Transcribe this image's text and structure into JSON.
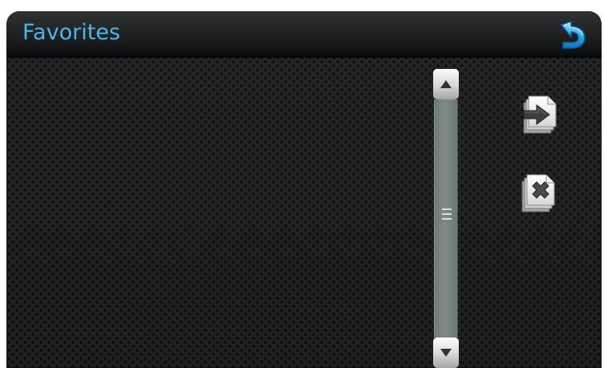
{
  "header": {
    "title": "Favorites",
    "back_icon": "undo-arrow-icon",
    "accent_color": "#4fb5ea"
  },
  "scrollbar": {
    "up_icon": "triangle-up-icon",
    "down_icon": "triangle-down-icon",
    "thumb_icon": "grip-lines-icon"
  },
  "actions": [
    {
      "name": "move-favorite",
      "icon": "document-arrow-icon"
    },
    {
      "name": "delete-favorite",
      "icon": "document-x-icon"
    }
  ],
  "list": {
    "items": []
  }
}
